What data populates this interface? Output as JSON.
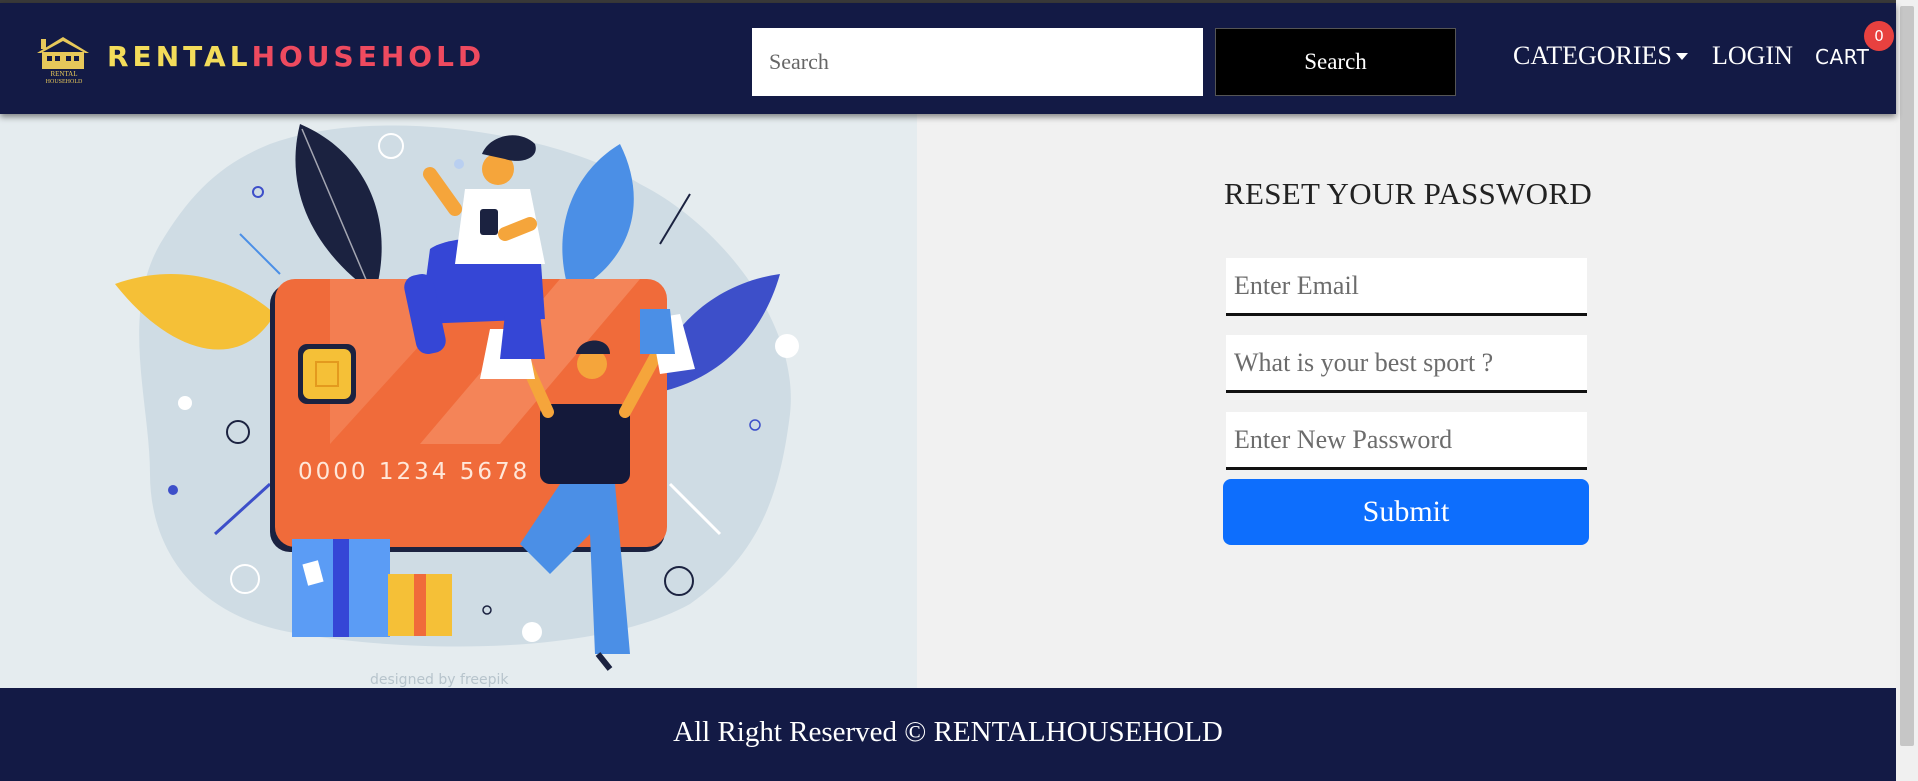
{
  "header": {
    "brand_part1": "RENTAL",
    "brand_part2": "HOUSEHOLD",
    "logo_text_line1": "RENTAL",
    "logo_text_line2": "HOUSEHOLD",
    "search": {
      "placeholder": "Search",
      "value": "",
      "button_label": "Search"
    },
    "nav": {
      "categories": "CATEGORIES",
      "login": "LOGIN",
      "cart": "CART",
      "cart_count": "0"
    }
  },
  "illustration": {
    "card_number": "0000 1234 5678 9",
    "credit": "designed by freepik"
  },
  "form": {
    "title": "RESET YOUR PASSWORD",
    "email_placeholder": "Enter Email",
    "question_placeholder": "What is your best sport ?",
    "password_placeholder": "Enter New Password",
    "submit_label": "Submit"
  },
  "footer": {
    "text": "All Right Reserved © RENTALHOUSEHOLD"
  },
  "colors": {
    "navbar": "#131a45",
    "brand_yellow": "#f3dc5a",
    "brand_red": "#ee4a5f",
    "primary_button": "#0d6efd",
    "badge": "#e8413f"
  }
}
